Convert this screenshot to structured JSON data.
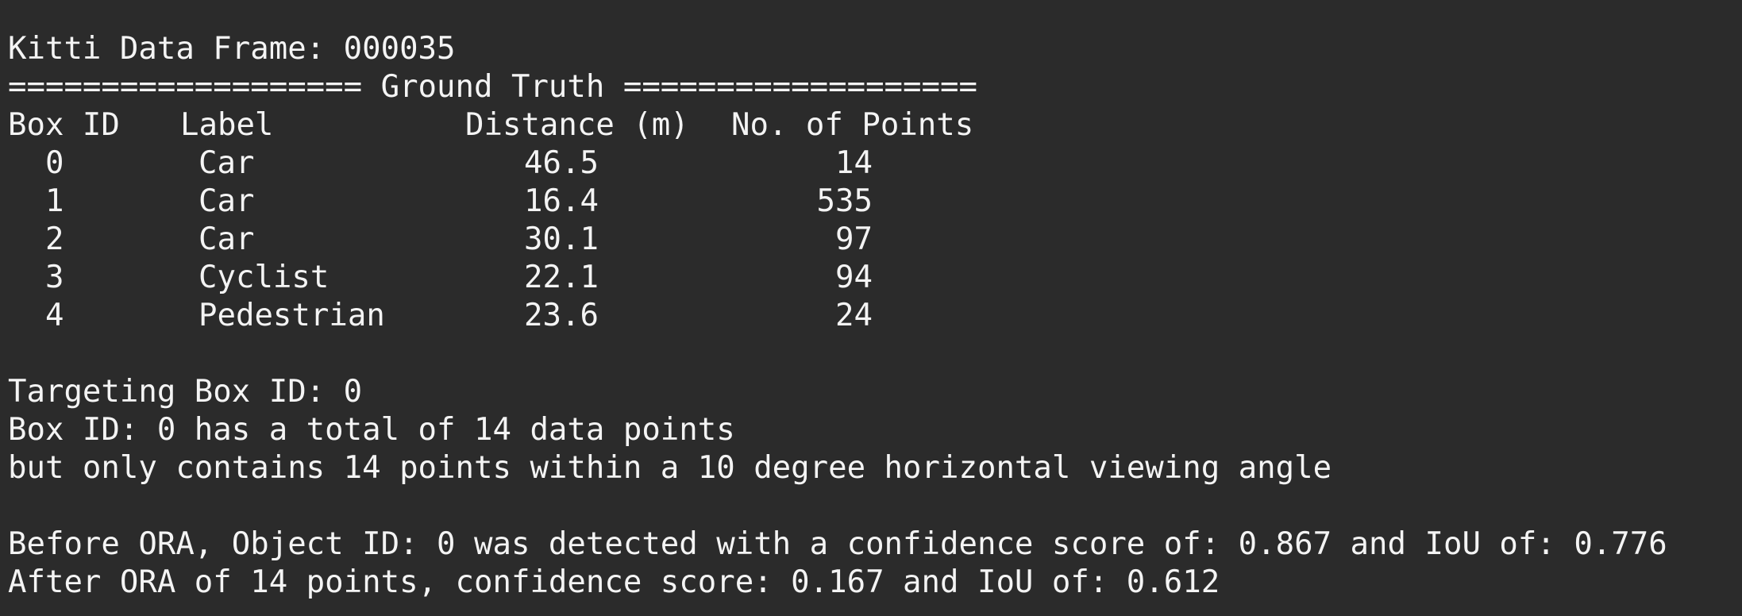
{
  "terminal": {
    "frame_line": "Kitti Data Frame: 000035",
    "section_header": "=================== Ground Truth ===================",
    "table": {
      "headers": {
        "box_id": "Box ID",
        "label": "Label",
        "distance": "Distance (m)",
        "points": "No. of Points"
      },
      "rows": [
        {
          "box_id": "0",
          "label": "Car",
          "distance": "46.5",
          "points": "14"
        },
        {
          "box_id": "1",
          "label": "Car",
          "distance": "16.4",
          "points": "535"
        },
        {
          "box_id": "2",
          "label": "Car",
          "distance": "30.1",
          "points": "97"
        },
        {
          "box_id": "3",
          "label": "Cyclist",
          "distance": "22.1",
          "points": "94"
        },
        {
          "box_id": "4",
          "label": "Pedestrian",
          "distance": "23.6",
          "points": "24"
        }
      ]
    },
    "targeting_line": "Targeting Box ID: 0",
    "total_points_line": "Box ID: 0 has a total of 14 data points",
    "viewing_angle_line": "but only contains 14 points within a 10 degree horizontal viewing angle",
    "before_ora_line": "Before ORA, Object ID: 0 was detected with a confidence score of: 0.867 and IoU of: 0.776",
    "after_ora_line": "After ORA of 14 points, confidence score: 0.167 and IoU of: 0.612"
  }
}
